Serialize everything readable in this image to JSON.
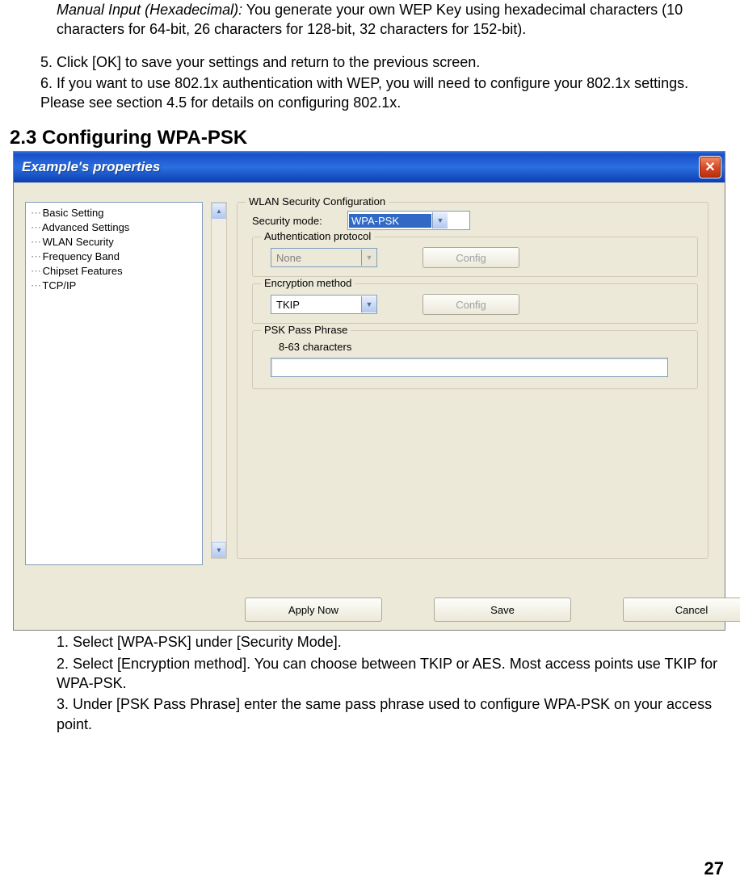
{
  "top_text": {
    "manual_input_label": "Manual Input (Hexadecimal):",
    "manual_input_rest": " You generate your own WEP Key using hexadecimal characters (10 characters for 64-bit, 26 characters for 128-bit, 32 characters for 152-bit).",
    "step5": "5. Click [OK] to save your settings and return to the previous screen.",
    "step6": "6. If you want to use 802.1x authentication with WEP, you will need to configure your 802.1x settings. Please see section 4.5 for details on configuring 802.1x."
  },
  "section_heading": "2.3 Configuring WPA-PSK",
  "dialog": {
    "title": "Example's properties",
    "tree": [
      "Basic Setting",
      "Advanced Settings",
      "WLAN Security",
      "Frequency Band",
      "Chipset Features",
      "TCP/IP"
    ],
    "group_main": "WLAN Security Configuration",
    "security_mode_label": "Security mode:",
    "security_mode_value": "WPA-PSK",
    "auth_group": "Authentication protocol",
    "auth_value": "None",
    "enc_group": "Encryption method",
    "enc_value": "TKIP",
    "config_btn": "Config",
    "psk_group": "PSK Pass Phrase",
    "psk_hint": "8-63 characters",
    "buttons": {
      "apply": "Apply Now",
      "save": "Save",
      "cancel": "Cancel"
    }
  },
  "bottom_steps": {
    "s1": "1. Select [WPA-PSK] under [Security Mode].",
    "s2": "2. Select [Encryption method]. You can choose between TKIP or AES. Most access points use TKIP for WPA-PSK.",
    "s3": "3. Under [PSK Pass Phrase] enter the same pass phrase used to configure WPA-PSK on your access point."
  },
  "page_number": "27"
}
